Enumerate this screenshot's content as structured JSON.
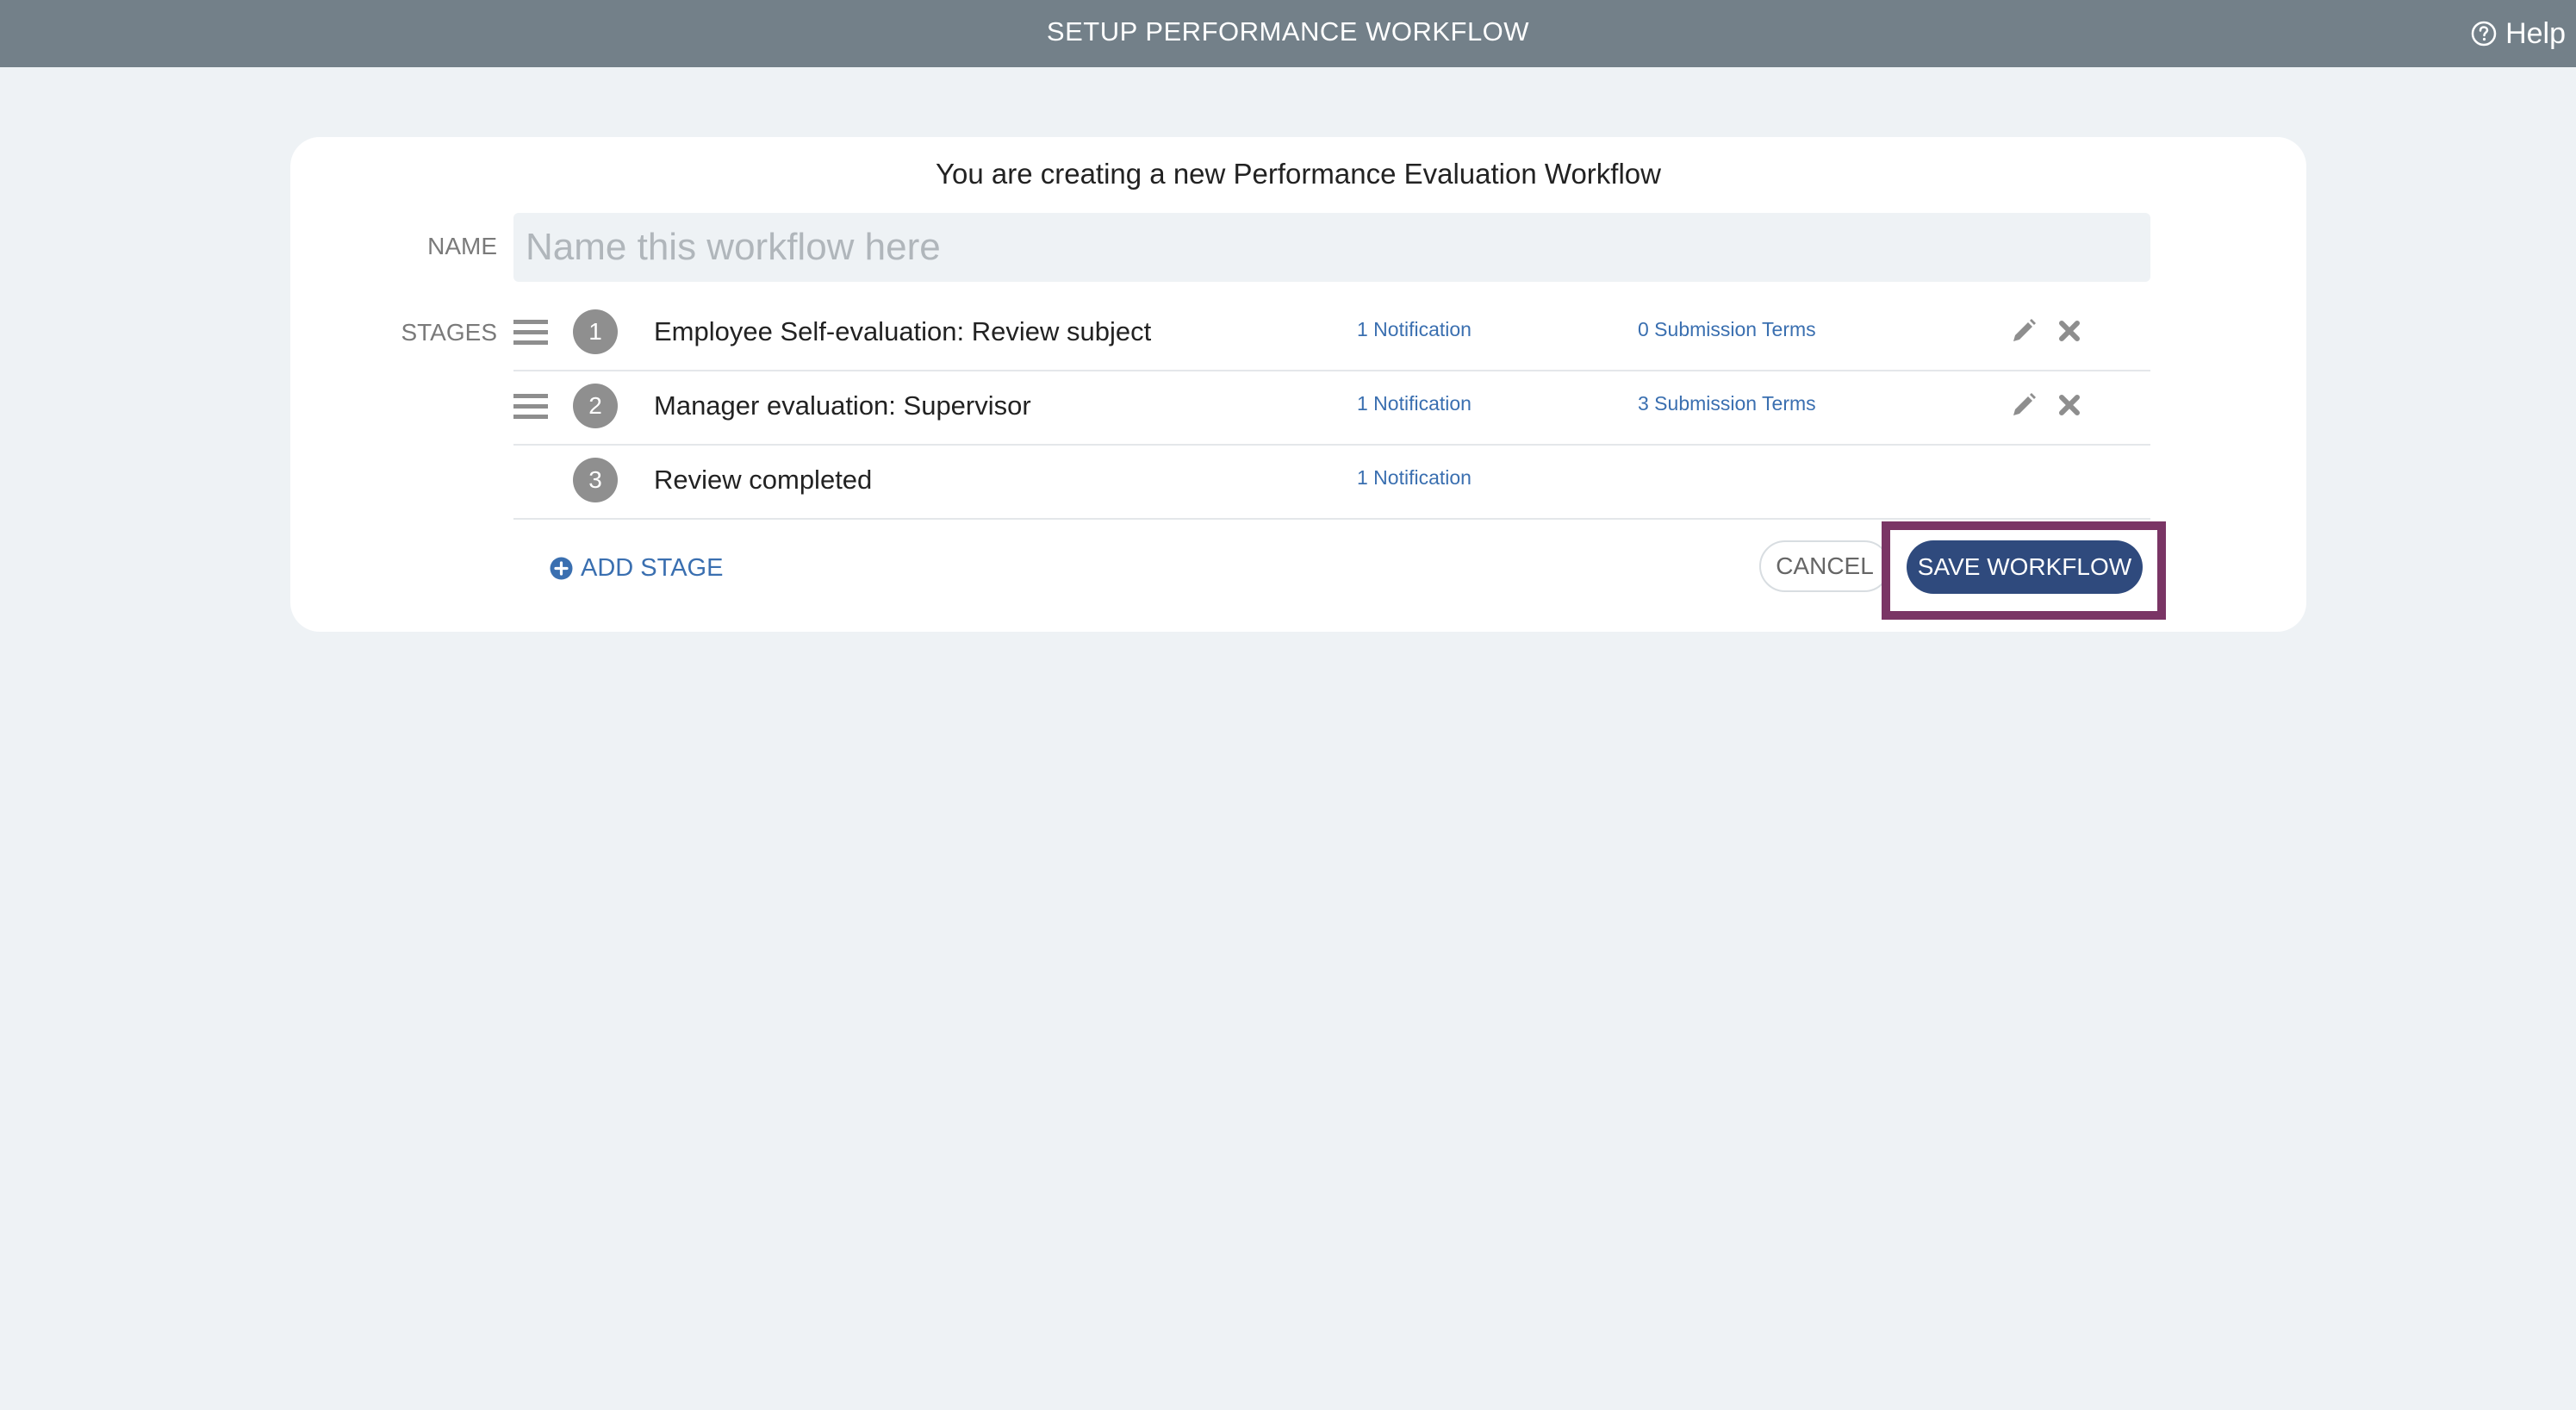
{
  "header": {
    "title": "SETUP PERFORMANCE WORKFLOW",
    "help_label": "Help",
    "help_icon": "question-circle-icon"
  },
  "form": {
    "heading": "You are creating a new Performance Evaluation Workflow",
    "name_label": "NAME",
    "name_value": "",
    "name_placeholder": "Name this workflow here",
    "stages_label": "STAGES"
  },
  "stages": [
    {
      "number": "1",
      "name": "Employee Self-evaluation: Review subject",
      "notifications": "1 Notification",
      "submission_terms": "0 Submission Terms",
      "has_actions": true
    },
    {
      "number": "2",
      "name": "Manager evaluation: Supervisor",
      "notifications": "1 Notification",
      "submission_terms": "3 Submission Terms",
      "has_actions": true
    },
    {
      "number": "3",
      "name": "Review completed",
      "notifications": "1 Notification",
      "submission_terms": "",
      "has_actions": false
    }
  ],
  "actions": {
    "add_stage_label": "ADD STAGE",
    "cancel_label": "CANCEL",
    "save_label": "SAVE WORKFLOW"
  },
  "colors": {
    "topbar": "#738089",
    "background": "#eef2f5",
    "link": "#3a6fb0",
    "primary_button": "#2f4a7d",
    "highlight_border": "#7a3565"
  }
}
